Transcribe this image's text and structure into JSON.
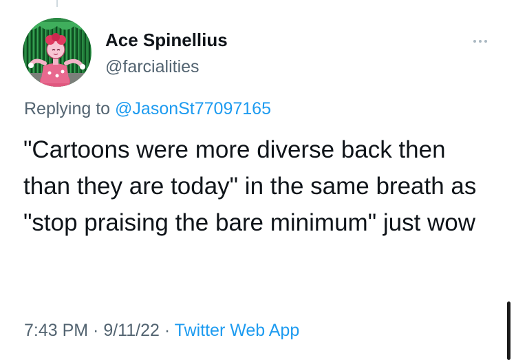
{
  "tweet": {
    "author": {
      "display_name": "Ace Spinellius",
      "handle": "@farcialities"
    },
    "reply_prefix": "Replying to ",
    "reply_to": "@JasonSt77097165",
    "text": "\"Cartoons were more diverse back then than they are today\" in the same breath as \"stop praising the bare minimum\" just wow",
    "time": "7:43 PM",
    "separator": " · ",
    "date": "9/11/22",
    "source": "Twitter Web App"
  },
  "icons": {
    "more": "more-options-icon"
  },
  "colors": {
    "text": "#0f1419",
    "secondary": "#536471",
    "link": "#1d9bf0"
  }
}
